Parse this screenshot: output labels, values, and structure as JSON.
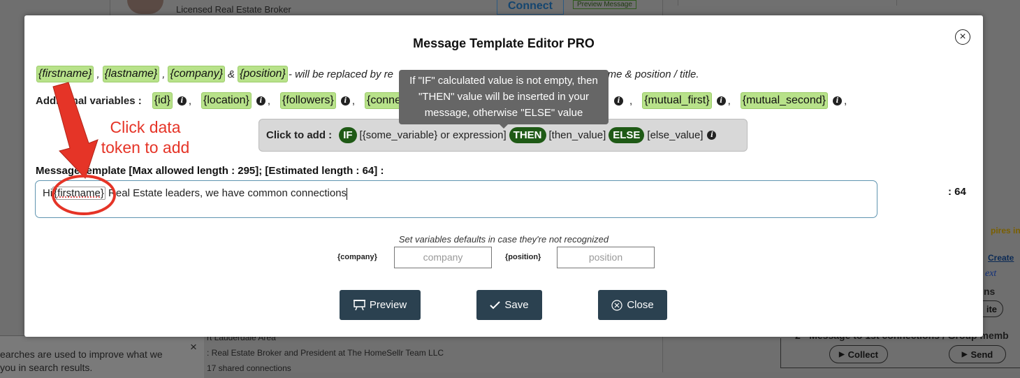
{
  "background": {
    "broker_title": "Licensed Real Estate Broker",
    "connect_label": "Connect",
    "preview_message_label": "Preview Message",
    "expires_text": "pires in",
    "create_text": "Create",
    "next_text": "ext",
    "ns_text": "ns",
    "ite_text": "ite",
    "area_text": "rt Lauderdale Area",
    "role_text": ": Real Estate Broker and President at The HomeSellr Team LLC",
    "shared_text": "17 shared connections",
    "message_campaign_text": "2 · Message to 1st connections / Group memb",
    "collect_label": "Collect",
    "send_label": "Send",
    "toast_line1": "earches are used to improve what we",
    "toast_line2": "you in search results.",
    "toast_close": "×"
  },
  "modal": {
    "title": "Message Template Editor PRO",
    "close_glyph": "×",
    "tokens_main": [
      "{firstname}",
      "{lastname}",
      "{company}",
      "{position}"
    ],
    "row1_sep_comma": ",",
    "row1_amp": "&",
    "row1_text": " - will be replaced by re",
    "row1_text_end": "ny name & position / title.",
    "additional_label": "Additional variables :",
    "additional_tokens": [
      "{id}",
      "{location}",
      "{followers}",
      "{connect",
      "{mutual_first}",
      "{mutual_second}"
    ],
    "if_box": {
      "cta": "Click to add :",
      "if_label": "IF",
      "if_text": "[{some_variable} or expression]",
      "then_label": "THEN",
      "then_text": "[then_value]",
      "else_label": "ELSE",
      "else_text": "[else_value]"
    },
    "tooltip": {
      "line1": "If \"IF\" calculated value is not empty, then",
      "line2": "\"THEN\" value will be inserted in your",
      "line3": "message, otherwise \"ELSE\" value"
    },
    "template_label": "Message template [Max allowed length : 295]; [Estimated length : 64] :",
    "template_prefix": "Hi",
    "template_token": "{firstname}",
    "template_rest": " Real Estate leaders, we have common connections",
    "length_count": ": 64",
    "defaults_caption": "Set variables defaults in case they're not recognized",
    "default_company_label": "{company}",
    "default_company_placeholder": "company",
    "default_position_label": "{position}",
    "default_position_placeholder": "position",
    "preview_label": "Preview",
    "save_label": "Save",
    "close_label": "Close"
  },
  "annotation": {
    "line1": "Click data",
    "line2": "token to add",
    "color": "#e53427"
  }
}
